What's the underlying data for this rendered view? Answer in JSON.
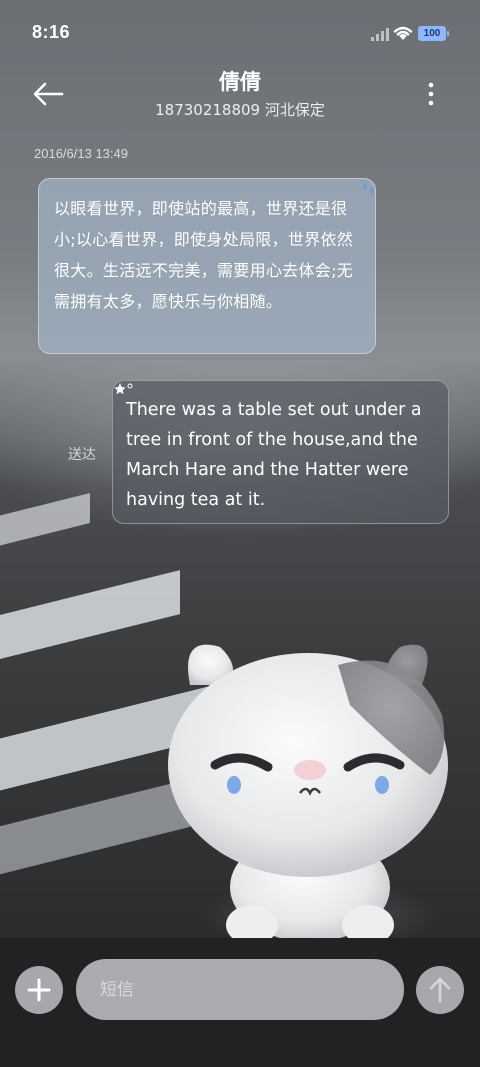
{
  "status_bar": {
    "time": "8:16",
    "battery": "100",
    "signal_icon": "cellular-signal-icon",
    "wifi_icon": "wifi-icon"
  },
  "header": {
    "back_icon": "arrow-left-icon",
    "contact_name": "倩倩",
    "contact_detail": "18730218809 河北保定",
    "more_icon": "more-vertical-icon"
  },
  "messages": {
    "timestamp": "2016/6/13 13:49",
    "incoming_text": "以眼看世界，即使站的最高，世界还是很小;以心看世界，即使身处局限，世界依然很大。生活远不完美，需要用心去体会;无需拥有太多，愿快乐与你相随。",
    "outgoing_text": "There was a table set out under a tree in front of the house,and the March Hare and the Hatter were having tea at it.",
    "outgoing_status": "送达"
  },
  "composer": {
    "add_icon": "plus-icon",
    "placeholder": "短信",
    "send_icon": "arrow-up-icon"
  },
  "colors": {
    "incoming_bubble": "#9eaec0",
    "outgoing_bubble": "#585c62",
    "input_bar": "#212223",
    "battery": "#8fb7ff"
  }
}
